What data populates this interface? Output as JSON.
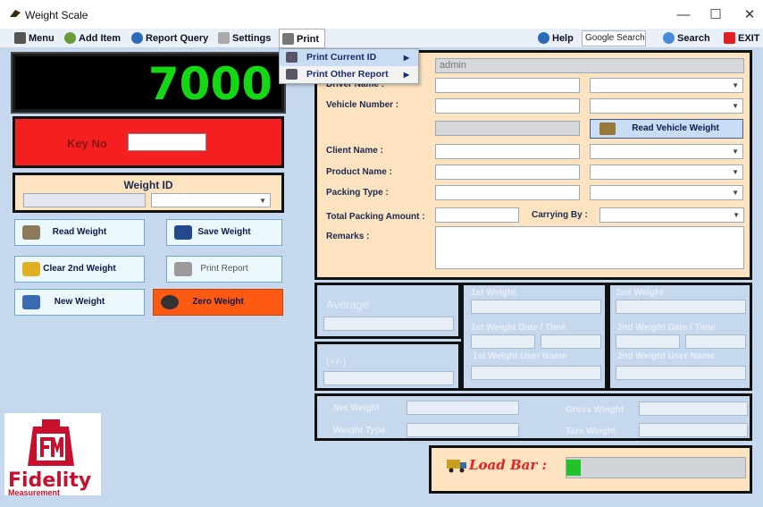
{
  "window": {
    "title": "Weight Scale",
    "min": "—",
    "max": "☐",
    "close": "✕"
  },
  "menu": {
    "menu": "Menu",
    "add_item": "Add Item",
    "report_query": "Report Query",
    "settings": "Settings",
    "print": "Print",
    "help": "Help",
    "search_value": "Google Search",
    "search": "Search",
    "exit": "EXIT"
  },
  "print_menu": {
    "current_id": "Print Current ID",
    "other_report": "Print Other Report"
  },
  "display": {
    "weight": "7000"
  },
  "key": {
    "label": "Key No"
  },
  "weight_id": {
    "label": "Weight ID"
  },
  "buttons": {
    "read_weight": "Read Weight",
    "save_weight": "Save Weight",
    "clear_2nd": "Clear 2nd Weight",
    "print_report": "Print Report",
    "new_weight": "New Weight",
    "zero_weight": "Zero Weight",
    "read_vehicle": "Read Vehicle Weight"
  },
  "form": {
    "user": "admin",
    "driver_name": "Driver Name :",
    "vehicle_number": "Vehicle Number :",
    "client_name": "Client Name :",
    "product_name": "Product Name :",
    "packing_type": "Packing Type :",
    "total_packing": "Total Packing Amount :",
    "carrying_by": "Carrying By :",
    "remarks": "Remarks :"
  },
  "stats": {
    "average": "Average",
    "plusminus": "(+/-)",
    "w1": "1st Weight",
    "w1_date": "1st Weight Date   /   Time",
    "w1_user": "1st Weight User Name",
    "w2": "2nd Weight",
    "w2_date": "2nd Weight Date   /   Time",
    "w2_user": "2nd Weight User Name"
  },
  "bottom": {
    "net": "Net Weight",
    "type": "Weight Type",
    "gross": "Gross Weight",
    "tare": "Tare Weight"
  },
  "loadbar": {
    "label": "Load Bar :",
    "level_percent": 8
  },
  "logo": {
    "name": "Fidelity",
    "sub": "Measurement"
  },
  "colors": {
    "accent": "#f42020",
    "panel": "#fde3c0",
    "display": "#14d814"
  }
}
